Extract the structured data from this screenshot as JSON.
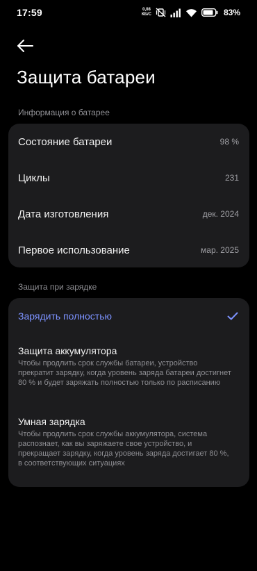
{
  "status_bar": {
    "time": "17:59",
    "net_speed_value": "0,08",
    "net_speed_unit": "КБ/С",
    "battery_percent": "83%",
    "icons": [
      "speed-indicator",
      "vibrate-off-icon",
      "signal-icon",
      "wifi-icon",
      "battery-icon"
    ]
  },
  "header": {
    "back_icon": "back-arrow-icon",
    "title": "Защита батареи"
  },
  "battery_info": {
    "section_title": "Информация о батарее",
    "rows": [
      {
        "label": "Состояние батареи",
        "value": "98 %"
      },
      {
        "label": "Циклы",
        "value": "231"
      },
      {
        "label": "Дата изготовления",
        "value": "дек. 2024"
      },
      {
        "label": "Первое использование",
        "value": "мар. 2025"
      }
    ]
  },
  "charging_protection": {
    "section_title": "Защита при зарядке",
    "options": [
      {
        "title": "Зарядить полностью",
        "selected": true
      },
      {
        "title": "Защита аккумулятора",
        "desc": "Чтобы продлить срок службы батареи, устройство прекратит зарядку, когда уровень заряда батареи достигнет 80 % и будет заряжать полностью только по расписанию"
      },
      {
        "title": "Умная зарядка",
        "desc": "Чтобы продлить срок службы аккумулятора, система распознает, как вы заряжаете свое устройство, и прекращает зарядку, когда уровень заряда достигает 80 %, в соответствующих ситуациях"
      }
    ]
  },
  "colors": {
    "background": "#000000",
    "card": "#1c1c1e",
    "accent": "#7c92ff",
    "secondary_text": "#8e8e93"
  }
}
